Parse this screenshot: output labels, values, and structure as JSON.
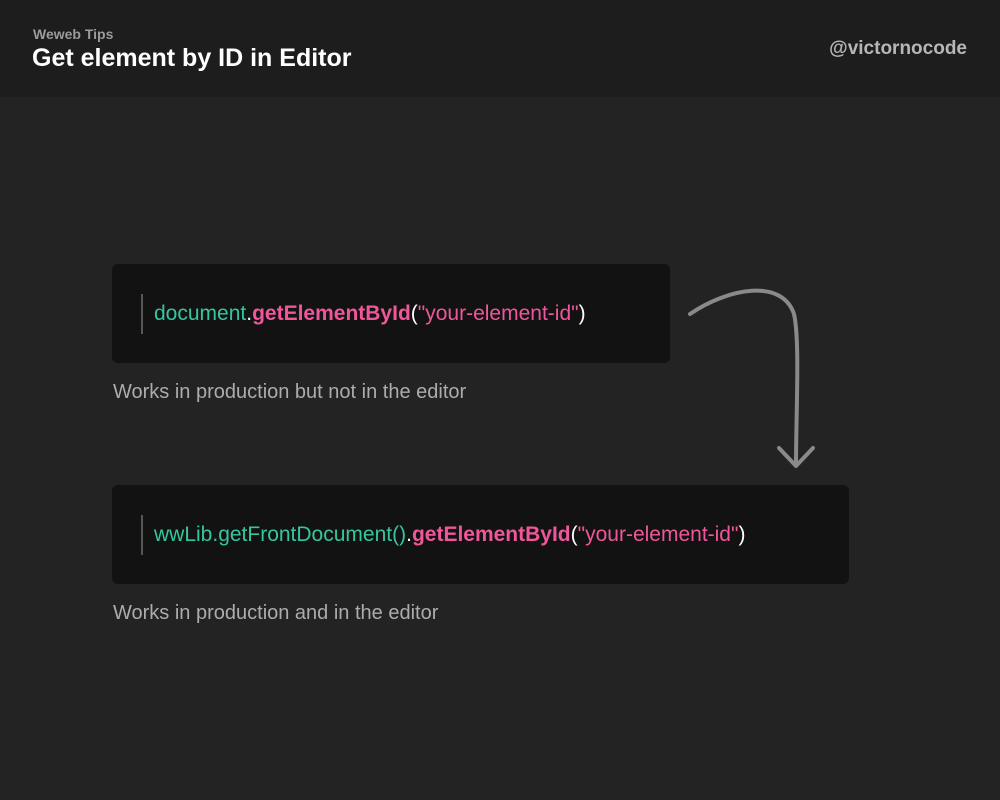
{
  "header": {
    "eyebrow": "Weweb Tips",
    "title": "Get element by ID in Editor",
    "handle": "@victornocode"
  },
  "snippets": [
    {
      "object": "document",
      "dot": ".",
      "method": "getElementById",
      "open_paren": "(",
      "argument": "\"your-element-id\"",
      "close_paren": ")",
      "caption": "Works in production but not in the editor"
    },
    {
      "object": "wwLib.getFrontDocument()",
      "dot": ".",
      "method": "getElementById",
      "open_paren": "(",
      "argument": "\"your-element-id\"",
      "close_paren": ")",
      "caption": "Works in production and in the editor"
    }
  ],
  "colors": {
    "background": "#232323",
    "header_background": "#1d1d1d",
    "code_background": "#121212",
    "object_color": "#35c6a0",
    "method_color": "#f0569a",
    "string_color": "#f0569a",
    "arrow_color": "#8a8a8a"
  },
  "icons": {
    "arrow": "curved-down-arrow-icon"
  }
}
